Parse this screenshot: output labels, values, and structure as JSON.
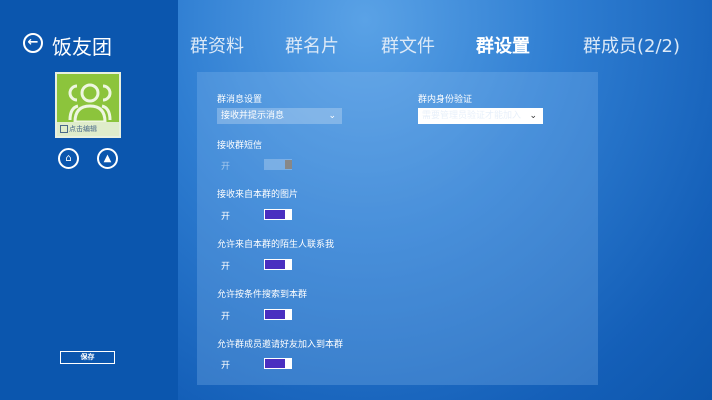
{
  "sidebar": {
    "title": "饭友团",
    "avatar_edit_label": "点击编辑",
    "save_label": "保存"
  },
  "tabs": [
    {
      "label": "群资料"
    },
    {
      "label": "群名片"
    },
    {
      "label": "群文件"
    },
    {
      "label": "群设置",
      "active": true
    },
    {
      "label": "群成员(2/2)"
    }
  ],
  "settings": {
    "message_setting_label": "群消息设置",
    "message_setting_value": "接收并提示消息",
    "verify_label": "群内身份验证",
    "verify_value": "需要管理员验证才能加入",
    "toggles": [
      {
        "label": "接收群短信",
        "state": "开",
        "on": false,
        "disabled": true
      },
      {
        "label": "接收来自本群的图片",
        "state": "开",
        "on": true
      },
      {
        "label": "允许来自本群的陌生人联系我",
        "state": "开",
        "on": true
      },
      {
        "label": "允许按条件搜索到本群",
        "state": "开",
        "on": true
      },
      {
        "label": "允许群成员邀请好友加入到本群",
        "state": "开",
        "on": true
      }
    ]
  },
  "colors": {
    "toggle_on": "#4a2fc0",
    "avatar_bg": "#8cc43c"
  }
}
